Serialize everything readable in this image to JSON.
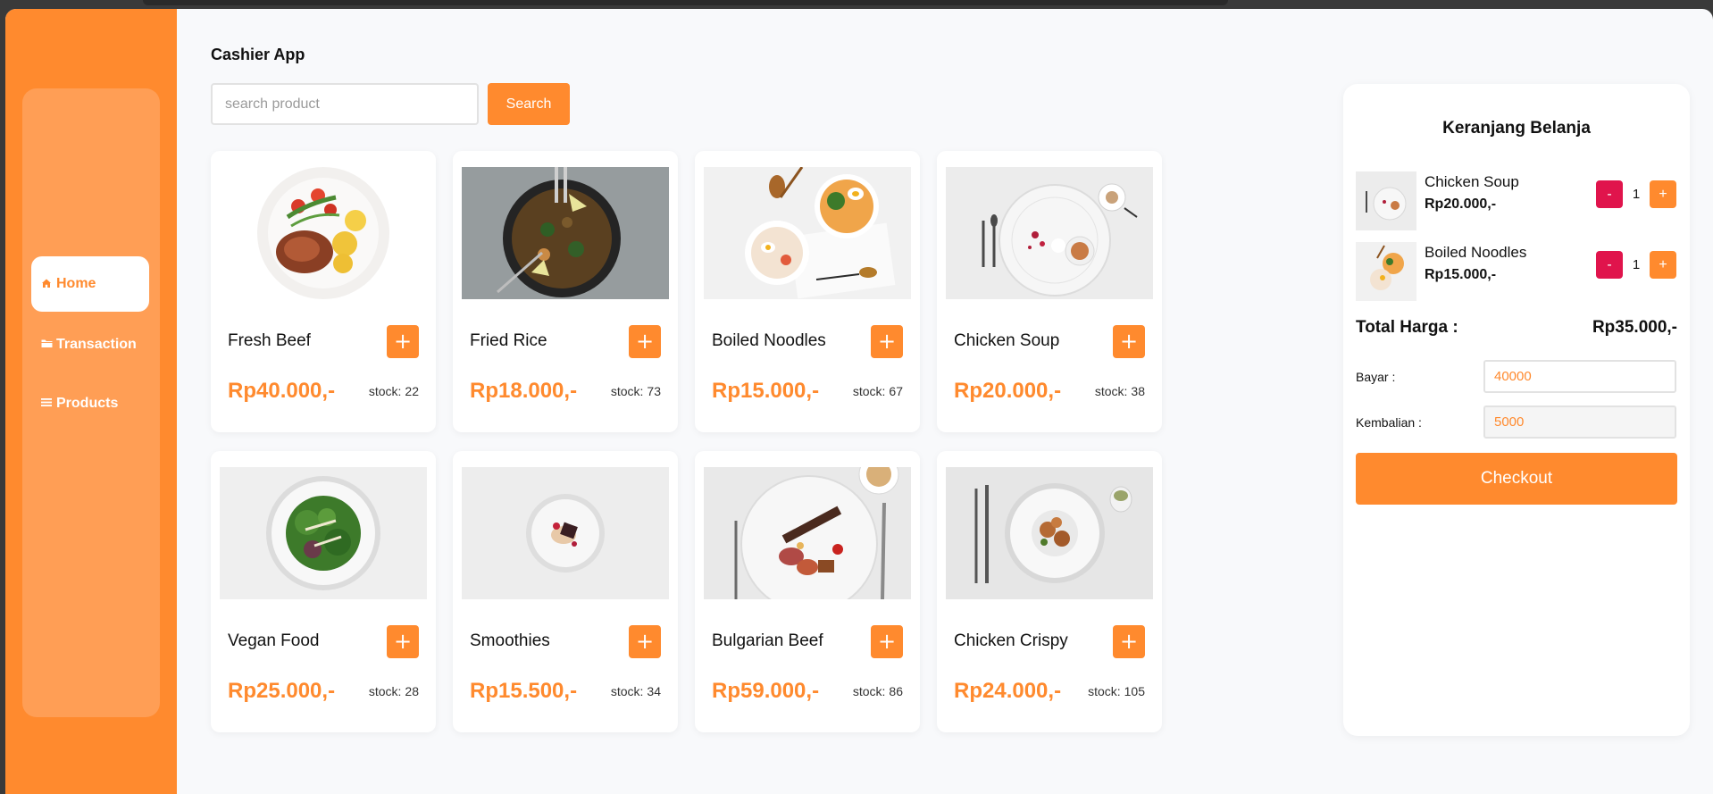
{
  "app": {
    "title": "Cashier App"
  },
  "sidebar": {
    "items": [
      {
        "label": "Home",
        "icon": "home-icon"
      },
      {
        "label": "Transaction",
        "icon": "folder-icon"
      },
      {
        "label": "Products",
        "icon": "menu-icon"
      }
    ],
    "active": "Home"
  },
  "search": {
    "placeholder": "search product",
    "value": "",
    "button_label": "Search"
  },
  "products": [
    {
      "name": "Fresh Beef",
      "price": "Rp40.000,-",
      "stock_label": "stock:",
      "stock": "22"
    },
    {
      "name": "Fried Rice",
      "price": "Rp18.000,-",
      "stock_label": "stock:",
      "stock": "73"
    },
    {
      "name": "Boiled Noodles",
      "price": "Rp15.000,-",
      "stock_label": "stock:",
      "stock": "67"
    },
    {
      "name": "Chicken Soup",
      "price": "Rp20.000,-",
      "stock_label": "stock:",
      "stock": "38"
    },
    {
      "name": "Vegan Food",
      "price": "Rp25.000,-",
      "stock_label": "stock:",
      "stock": "28"
    },
    {
      "name": "Smoothies",
      "price": "Rp15.500,-",
      "stock_label": "stock:",
      "stock": "34"
    },
    {
      "name": "Bulgarian Beef",
      "price": "Rp59.000,-",
      "stock_label": "stock:",
      "stock": "86"
    },
    {
      "name": "Chicken Crispy",
      "price": "Rp24.000,-",
      "stock_label": "stock:",
      "stock": "105"
    }
  ],
  "add_button_label": "+",
  "cart": {
    "title": "Keranjang Belanja",
    "items": [
      {
        "name": "Chicken Soup",
        "price": "Rp20.000,-",
        "qty": "1"
      },
      {
        "name": "Boiled Noodles",
        "price": "Rp15.000,-",
        "qty": "1"
      }
    ],
    "minus_label": "-",
    "plus_label": "+",
    "total_label": "Total Harga :",
    "total_value": "Rp35.000,-",
    "pay_label": "Bayar :",
    "pay_value": "40000",
    "change_label": "Kembalian :",
    "change_value": "5000",
    "checkout_label": "Checkout"
  },
  "colors": {
    "accent": "#ff8a2e",
    "danger": "#e0144c",
    "background": "#f8f9fb"
  }
}
